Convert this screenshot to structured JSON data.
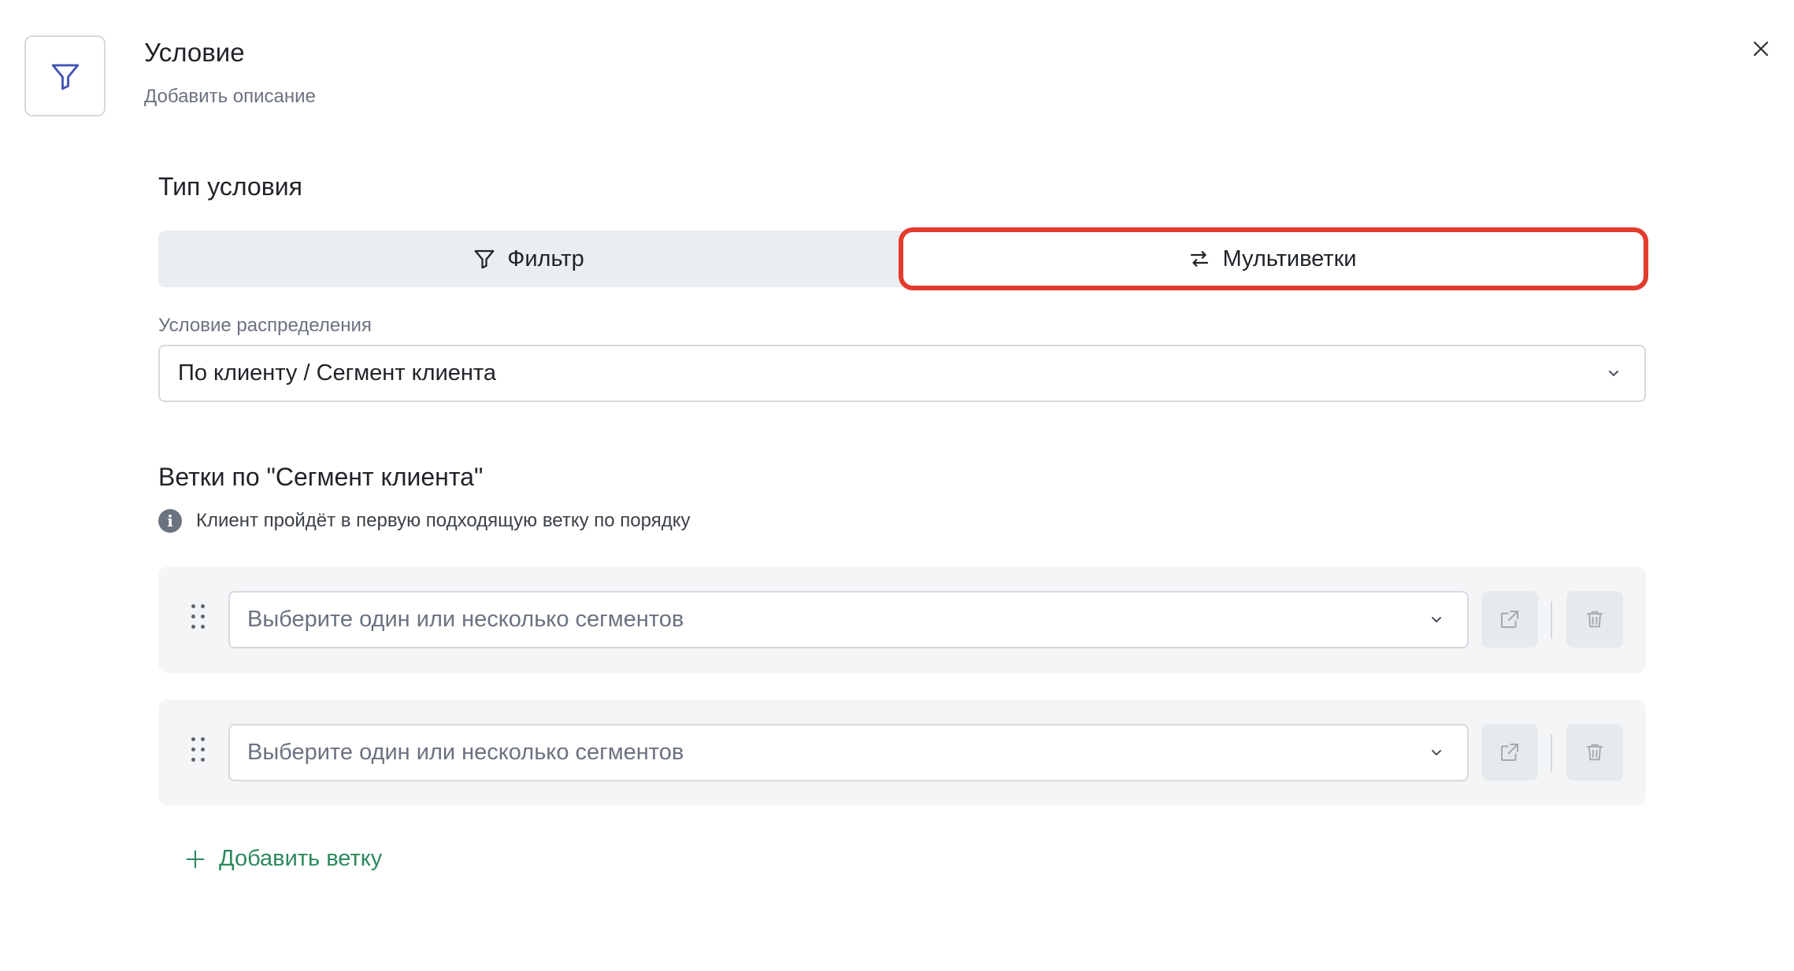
{
  "header": {
    "title": "Условие",
    "description_placeholder": "Добавить описание",
    "node_icon": "filter-icon",
    "close_icon": "close-icon"
  },
  "condition_type": {
    "title": "Тип условия",
    "options": [
      {
        "label": "Фильтр",
        "icon": "filter-icon",
        "selected": false
      },
      {
        "label": "Мультиветки",
        "icon": "split-arrows-icon",
        "selected": true
      }
    ],
    "highlight_color": "#e33b2c"
  },
  "distribution": {
    "label": "Условие распределения",
    "value": "По клиенту / Сегмент клиента"
  },
  "branches": {
    "title": "Ветки по \"Сегмент клиента\"",
    "info": "Клиент пройдёт в первую подходящую ветку по порядку",
    "items": [
      {
        "placeholder": "Выберите один или несколько сегментов"
      },
      {
        "placeholder": "Выберите один или несколько сегментов"
      }
    ],
    "add_label": "Добавить ветку"
  },
  "colors": {
    "accent_green": "#2c8a5c",
    "switch_bg": "#ebeef0",
    "branch_bg": "#f3f5f6"
  }
}
